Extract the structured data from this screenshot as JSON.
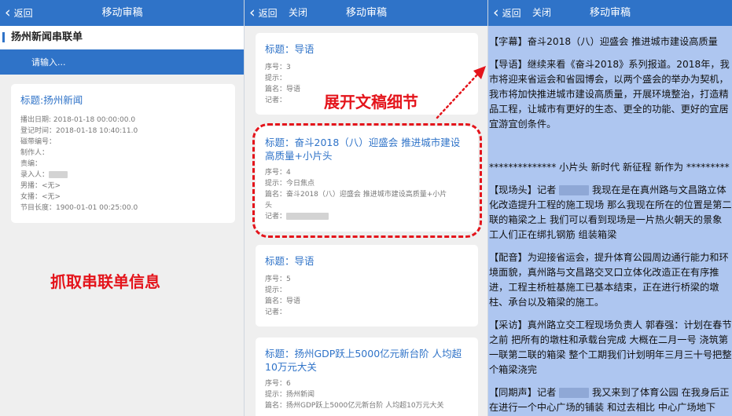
{
  "screen1": {
    "back_label": "返回",
    "title": "移动审稿",
    "rundown_title": "扬州新闻串联单",
    "search_placeholder": "请输入...",
    "card": {
      "title": "标题:扬州新闻",
      "fields": [
        "播出日期: 2018-01-18 00:00:00.0",
        "登记时间：2018-01-18 10:40:11.0",
        "磁带编号：",
        "制作人：",
        "责编：",
        "录入人：",
        "男播：<无>",
        "女播：<无>",
        "节目长度：1900-01-01 00:25:00.0"
      ]
    },
    "caption": "抓取串联单信息"
  },
  "screen2": {
    "back_label": "返回",
    "close_label": "关闭",
    "title": "移动审稿",
    "cards": [
      {
        "title": "标题：导语",
        "fields": [
          "序号：3",
          "提示：",
          "篇名：导语",
          "记者："
        ]
      },
      {
        "title": "标题：奋斗2018（八）迎盛会 推进城市建设高质量+小片头",
        "fields": [
          "序号：4",
          "提示：今日焦点",
          "篇名：奋斗2018（八）迎盛会 推进城市建设高质量+小片",
          "头",
          "记者："
        ]
      },
      {
        "title": "标题：导语",
        "fields": [
          "序号：5",
          "提示：",
          "篇名：导语",
          "记者："
        ]
      },
      {
        "title": "标题：扬州GDP跃上5000亿元新台阶 人均超10万元大关",
        "fields": [
          "序号：6",
          "提示：扬州新闻",
          "篇名：扬州GDP跃上5000亿元新台阶 人均超10万元大关"
        ]
      }
    ],
    "caption": "展开文稿细节"
  },
  "screen3": {
    "back_label": "返回",
    "close_label": "关闭",
    "title": "移动审稿",
    "paragraphs": [
      "【字幕】奋斗2018（八）迎盛会 推进城市建设高质量",
      "【导语】继续来看《奋斗2018》系列报道。2018年，我市将迎来省运会和省园博会，以两个盛会的举办为契机，我市将加快推进城市建设高质量，开展环境整治，打造精品工程，让城市有更好的生态、更全的功能、更好的宜居宜游宜创条件。",
      "************** 小片头 新时代 新征程 新作为 *********",
      "【现场头】记者 [blur] 我现在是在真州路与文昌路立体化改造提升工程的施工现场 那么我现在所在的位置是第二联的箱梁之上 我们可以看到现场是一片热火朝天的景象 工人们正在绑扎钢筋 组装箱梁",
      "【配音】为迎接省运会，提升体育公园周边通行能力和环境面貌，真州路与文昌路交叉口立体化改造正在有序推进，工程主桥桩基施工已基本结束，正在进行桥梁的墩柱、承台以及箱梁的施工。",
      "【采访】真州路立交工程现场负责人 郭春强：计划在春节之前 把所有的墩柱和承载台完成 大概在二月一号 浇筑第一联第二联的箱梁 整个工期我们计划明年三月三十号把整个箱梁浇完",
      "【同期声】记者 [blur] 我又来到了体育公园 在我身后正在进行一个中心广场的铺装 和过去相比 中心广场地下"
    ]
  }
}
